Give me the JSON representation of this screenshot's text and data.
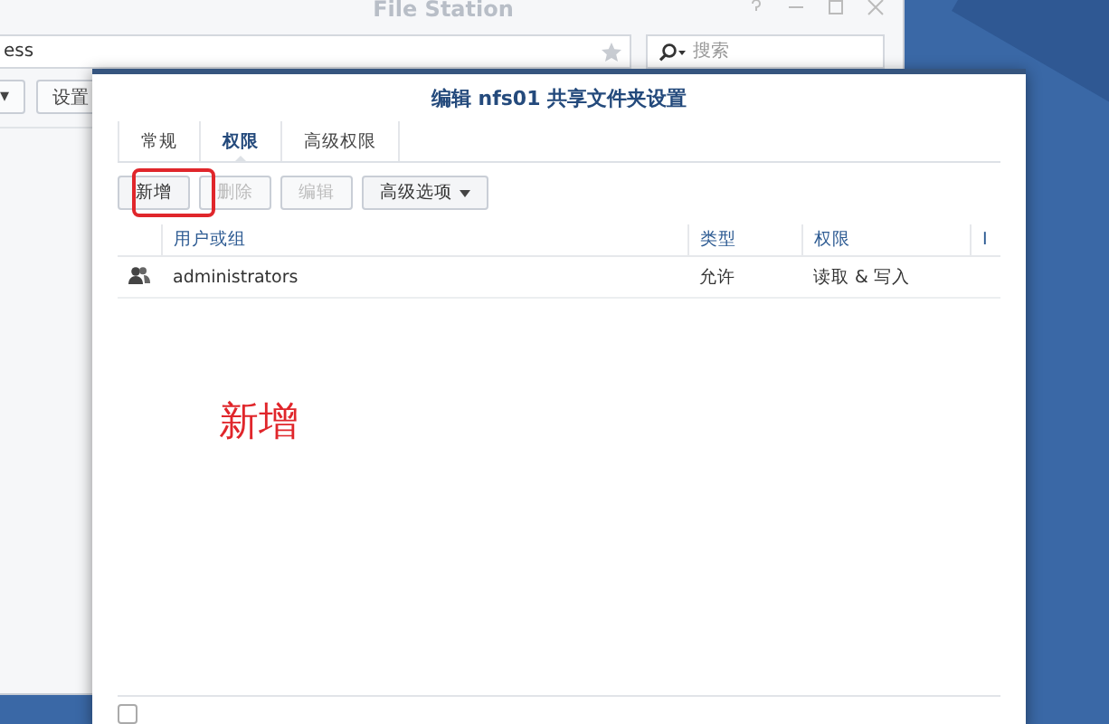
{
  "file_station": {
    "title": "File Station",
    "path": "ess",
    "search": {
      "placeholder": "搜索"
    },
    "toolbar": [
      {
        "label": "▾"
      },
      {
        "label": "设置"
      }
    ]
  },
  "dialog": {
    "title": "编辑 nfs01 共享文件夹设置",
    "tabs": [
      {
        "label": "常规",
        "selected": false
      },
      {
        "label": "权限",
        "selected": true
      },
      {
        "label": "高级权限",
        "selected": false
      }
    ],
    "buttons": [
      {
        "label": "新增",
        "disabled": false,
        "highlighted": true
      },
      {
        "label": "删除",
        "disabled": true,
        "highlighted": false
      },
      {
        "label": "编辑",
        "disabled": true,
        "highlighted": false
      },
      {
        "label": "高级选项",
        "disabled": false,
        "highlighted": false,
        "dropdown": true
      }
    ],
    "table": {
      "columns": [
        "用户或组",
        "类型",
        "权限",
        "I"
      ],
      "rows": [
        {
          "name": "administrators",
          "type": "允许",
          "permission": "读取 & 写入"
        }
      ]
    },
    "footer_checkbox": {
      "checked": false
    }
  },
  "annotation": "新增"
}
